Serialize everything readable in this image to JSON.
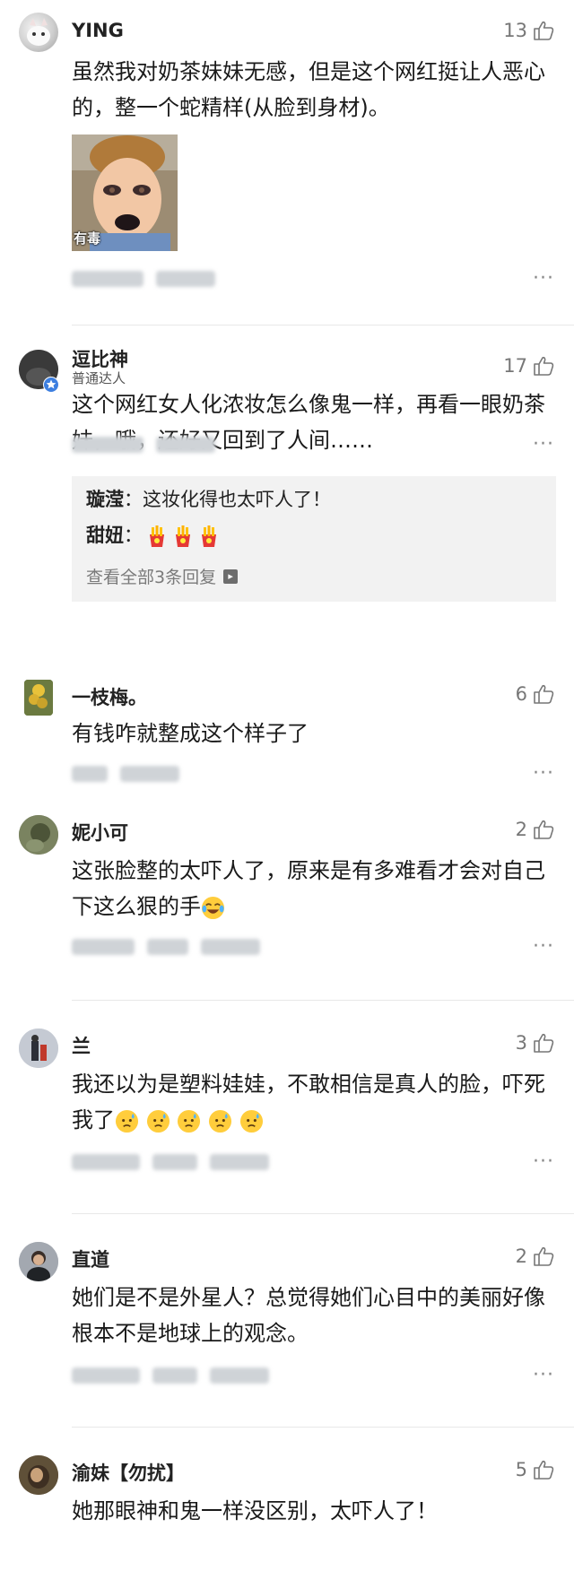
{
  "comments": [
    {
      "name": "YING",
      "likes": "13",
      "text": "虽然我对奶茶妹妹无感，但是这个网红挺让人恶心的，整一个蛇精样(从脸到身材)。",
      "sticker_caption": "有毒"
    },
    {
      "name": "逗比神",
      "badge": "普通达人",
      "likes": "17",
      "text": "这个网红女人化浓妆怎么像鬼一样，再看一眼奶茶妹，哦，还好又回到了人间……",
      "replies": {
        "r1_name": "璇滢",
        "r1_text": "：这妆化得也太吓人了！",
        "r2_name": "甜妞",
        "r2_text": "：",
        "view_all": "查看全部3条回复"
      }
    },
    {
      "name": "一枝梅。",
      "likes": "6",
      "text": "有钱咋就整成这个样子了"
    },
    {
      "name": "妮小可",
      "likes": "2",
      "text": "这张脸整的太吓人了，原来是有多难看才会对自己下这么狠的手"
    },
    {
      "name": "兰",
      "likes": "3",
      "text": "我还以为是塑料娃娃，不敢相信是真人的脸，吓死我了"
    },
    {
      "name": "直道",
      "likes": "2",
      "text": "她们是不是外星人？总觉得她们心目中的美丽好像根本不是地球上的观念。"
    },
    {
      "name": "渝妹【勿扰】",
      "likes": "5",
      "text": "她那眼神和鬼一样没区别，太吓人了！"
    }
  ],
  "more_label": "···",
  "icons": {
    "like": "thumbs-up-icon",
    "more": "more-icon",
    "arrow": "arrow-right-icon"
  },
  "colors": {
    "reply_bg": "#f2f2f2",
    "muted": "#777777",
    "divider": "#e8e8e8"
  }
}
